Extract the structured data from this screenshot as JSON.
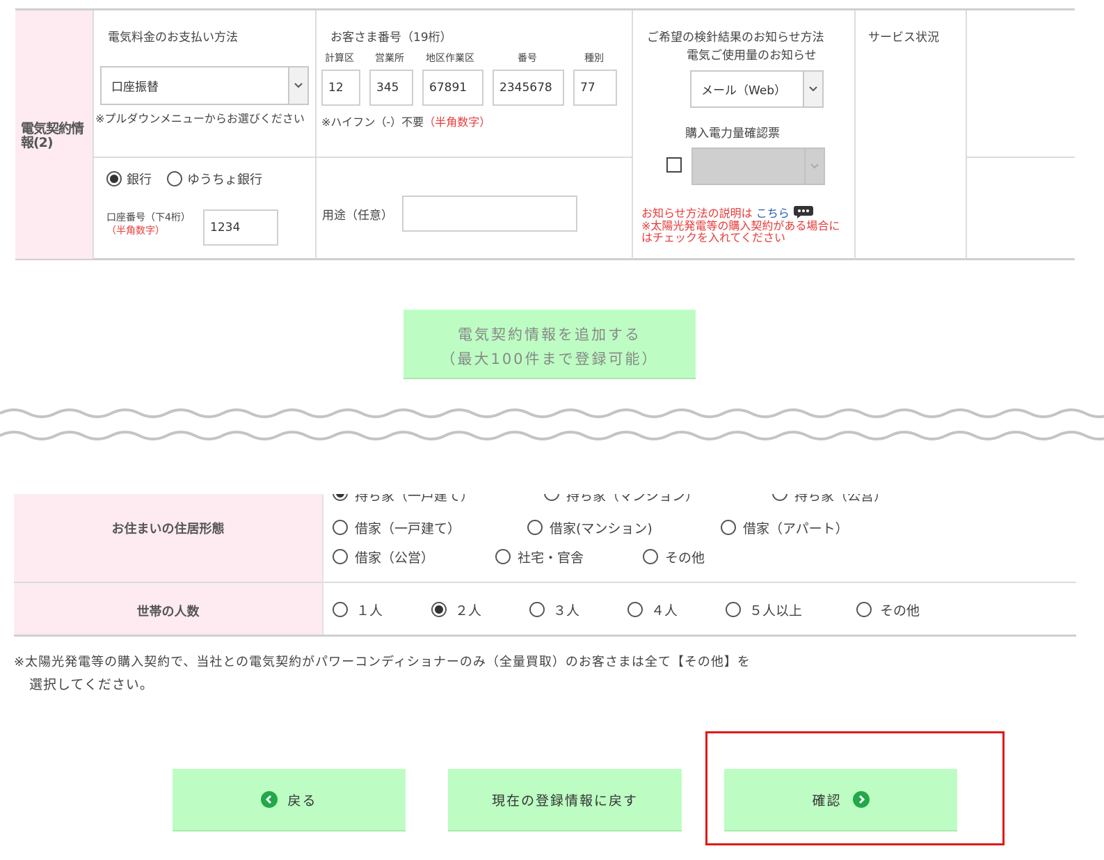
{
  "contract": {
    "section_label": "電気契約情報(2)",
    "payment": {
      "label": "電気料金のお支払い方法",
      "selected": "口座振替",
      "note": "※プルダウンメニューからお選びください"
    },
    "customer_number": {
      "label": "お客さま番号（19桁）",
      "fields": [
        {
          "header": "計算区",
          "value": "12"
        },
        {
          "header": "営業所",
          "value": "345"
        },
        {
          "header": "地区作業区",
          "value": "67891"
        },
        {
          "header": "番号",
          "value": "2345678"
        },
        {
          "header": "種別",
          "value": "77"
        }
      ],
      "note": "※ハイフン（-）不要",
      "note_red": "（半角数字）"
    },
    "notification": {
      "label_line1": "ご希望の検針結果のお知らせ方法",
      "label_line2": "電気ご使用量のお知らせ",
      "selected": "メール（Web）",
      "purchase_label": "購入電力量確認票",
      "explain_prefix": "お知らせ方法の説明は",
      "explain_link": "こちら",
      "explain_note": "※太陽光発電等の購入契約がある場合にはチェックを入れてください"
    },
    "service_status_label": "サービス状況",
    "bank": {
      "options": [
        "銀行",
        "ゆうちょ銀行"
      ],
      "selected_index": 0,
      "account_label": "口座番号（下4桁）",
      "account_label_red": "（半角数字）",
      "account_value": "1234"
    },
    "usage": {
      "label": "用途（任意）",
      "value": ""
    }
  },
  "add_button": {
    "line1": "電気契約情報を追加する",
    "line2": "（最大100件まで登録可能）"
  },
  "housing": {
    "label": "お住まいの住居形態",
    "row1": [
      "持ち家（一戸建て）",
      "持ち家（マンション）",
      "持ち家（公営）"
    ],
    "row2": [
      "借家（一戸建て）",
      "借家(マンション)",
      "借家（アパート）"
    ],
    "row3": [
      "借家（公営）",
      "社宅・官舎",
      "その他"
    ],
    "selected": "持ち家（一戸建て）"
  },
  "household": {
    "label": "世帯の人数",
    "options": [
      "１人",
      "２人",
      "３人",
      "４人",
      "５人以上",
      "その他"
    ],
    "selected": "２人"
  },
  "footnote": {
    "line1": "※太陽光発電等の購入契約で、当社との電気契約がパワーコンディショナーのみ（全量買取）のお客さまは全て【その他】を",
    "line2": "選択してください。"
  },
  "actions": {
    "back": "戻る",
    "reset": "現在の登録情報に戻す",
    "confirm": "確認"
  },
  "colors": {
    "button_bg": "#bdfdc3",
    "label_bg": "#fdebf1",
    "accent_green": "#21a84a",
    "note_red": "#e83a3a",
    "highlight": "#e01818"
  }
}
